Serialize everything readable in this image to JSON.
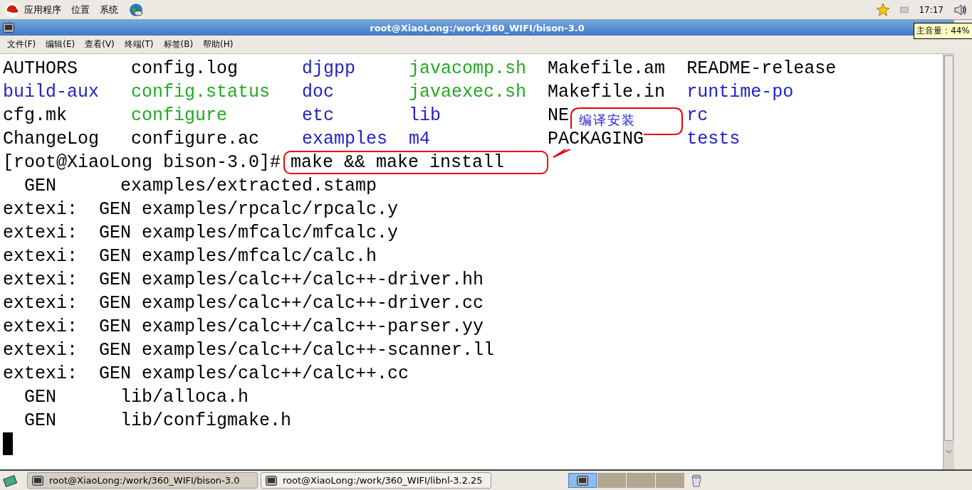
{
  "top_panel": {
    "menus": [
      "应用程序",
      "位置",
      "系统"
    ],
    "clock": "17:17"
  },
  "tooltip": "主音量：44%",
  "window": {
    "title": "root@XiaoLong:/work/360_WIFI/bison-3.0"
  },
  "menu_bar": [
    "文件(F)",
    "编辑(E)",
    "查看(V)",
    "终端(T)",
    "标签(B)",
    "帮助(H)"
  ],
  "terminal": {
    "listing": [
      [
        {
          "text": "AUTHORS",
          "color": "#000000"
        },
        {
          "text": "config.log",
          "color": "#000000"
        },
        {
          "text": "djgpp",
          "color": "#2222cc"
        },
        {
          "text": "javacomp.sh",
          "color": "#22aa22"
        },
        {
          "text": "Makefile.am",
          "color": "#000000"
        },
        {
          "text": "README-release",
          "color": "#000000"
        }
      ],
      [
        {
          "text": "build-aux",
          "color": "#2222cc"
        },
        {
          "text": "config.status",
          "color": "#22aa22"
        },
        {
          "text": "doc",
          "color": "#2222cc"
        },
        {
          "text": "javaexec.sh",
          "color": "#22aa22"
        },
        {
          "text": "Makefile.in",
          "color": "#000000"
        },
        {
          "text": "runtime-po",
          "color": "#2222cc"
        }
      ],
      [
        {
          "text": "cfg.mk",
          "color": "#000000"
        },
        {
          "text": "configure",
          "color": "#22aa22"
        },
        {
          "text": "etc",
          "color": "#2222cc"
        },
        {
          "text": "lib",
          "color": "#2222cc"
        },
        {
          "text": "NE",
          "color": "#000000"
        },
        {
          "text": "rc",
          "color": "#2222cc"
        }
      ],
      [
        {
          "text": "ChangeLog",
          "color": "#000000"
        },
        {
          "text": "configure.ac",
          "color": "#000000"
        },
        {
          "text": "examples",
          "color": "#2222cc"
        },
        {
          "text": "m4",
          "color": "#2222cc"
        },
        {
          "text": "PACKAGING",
          "color": "#000000"
        },
        {
          "text": "tests",
          "color": "#2222cc"
        }
      ]
    ],
    "prompt": "[root@XiaoLong bison-3.0]#",
    "command": "make && make install",
    "output": [
      "  GEN      examples/extracted.stamp",
      "extexi:  GEN examples/rpcalc/rpcalc.y",
      "extexi:  GEN examples/mfcalc/mfcalc.y",
      "extexi:  GEN examples/mfcalc/calc.h",
      "extexi:  GEN examples/calc++/calc++-driver.hh",
      "extexi:  GEN examples/calc++/calc++-driver.cc",
      "extexi:  GEN examples/calc++/calc++-parser.yy",
      "extexi:  GEN examples/calc++/calc++-scanner.ll",
      "extexi:  GEN examples/calc++/calc++.cc",
      "  GEN      lib/alloca.h",
      "  GEN      lib/configmake.h"
    ]
  },
  "callout": {
    "text": "编译安装"
  },
  "taskbar": {
    "tasks": [
      {
        "label": "root@XiaoLong:/work/360_WIFI/bison-3.0",
        "selected": true
      },
      {
        "label": "root@XiaoLong:/work/360_WIFI/libnl-3.2.25",
        "selected": false
      }
    ],
    "workspaces": [
      {
        "selected": true
      },
      {
        "selected": false
      },
      {
        "selected": false
      },
      {
        "selected": false
      }
    ]
  }
}
